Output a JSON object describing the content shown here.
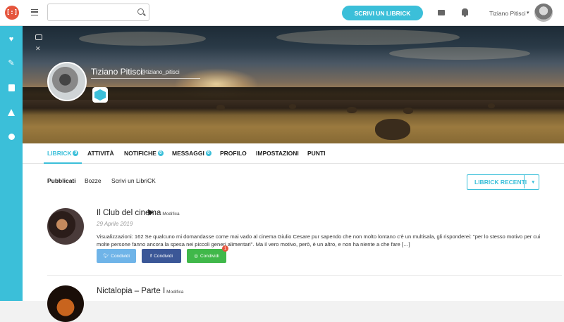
{
  "app": {
    "logo_text": "[:]"
  },
  "header": {
    "cta_label": "SCRIVI UN LIBRICK",
    "user_name": "Tiziano Pitisci",
    "user_dropdown": "▾",
    "search": {
      "placeholder": "",
      "value": ""
    }
  },
  "sidebar": {
    "icons": [
      "heart-icon",
      "pencil-icon",
      "book-icon",
      "flask-icon",
      "bomb-icon"
    ]
  },
  "profile": {
    "name": "Tiziano Pitisci",
    "handle": "@tiziano_pitisci"
  },
  "tabs": [
    {
      "label": "LIBRICK",
      "count": "0",
      "active": true
    },
    {
      "label": "ATTIVITÀ"
    },
    {
      "label": "NOTIFICHE",
      "count": "0"
    },
    {
      "label": "MESSAGGI",
      "count": "0"
    },
    {
      "label": "PROFILO"
    },
    {
      "label": "IMPOSTAZIONI"
    },
    {
      "label": "PUNTI"
    }
  ],
  "subtabs": [
    "Pubblicati",
    "Bozze",
    "Scrivi un LibriCK"
  ],
  "recent_dropdown": {
    "label": "LIBRICK RECENTI",
    "chevron": "▾"
  },
  "posts": [
    {
      "title": "Il Club del cinema",
      "edit": "Modifica",
      "date": "29 Aprile 2019",
      "excerpt": "Visualizzazioni: 162 Se qualcuno mi domandasse come mai vado al cinema Giulio Cesare pur sapendo che non molto lontano c'è un multisala, gli risponderei: \"per lo stesso motivo per cui molte persone fanno ancora la spesa nei piccoli generi alimentari\". Ma il vero motivo, però, è un altro, e non ha niente a che fare […]",
      "share": {
        "twitter": "Condividi",
        "facebook": "Condividi",
        "whatsapp": "Condividi",
        "whatsapp_badge": "1"
      }
    },
    {
      "title": "Nictalopia – Parte I",
      "edit": "Modifica"
    }
  ],
  "colors": {
    "accent": "#3bbfd9",
    "logo": "#e5553d",
    "facebook": "#3b5797",
    "whatsapp": "#40b84a",
    "twitter": "#6fb4e8"
  }
}
